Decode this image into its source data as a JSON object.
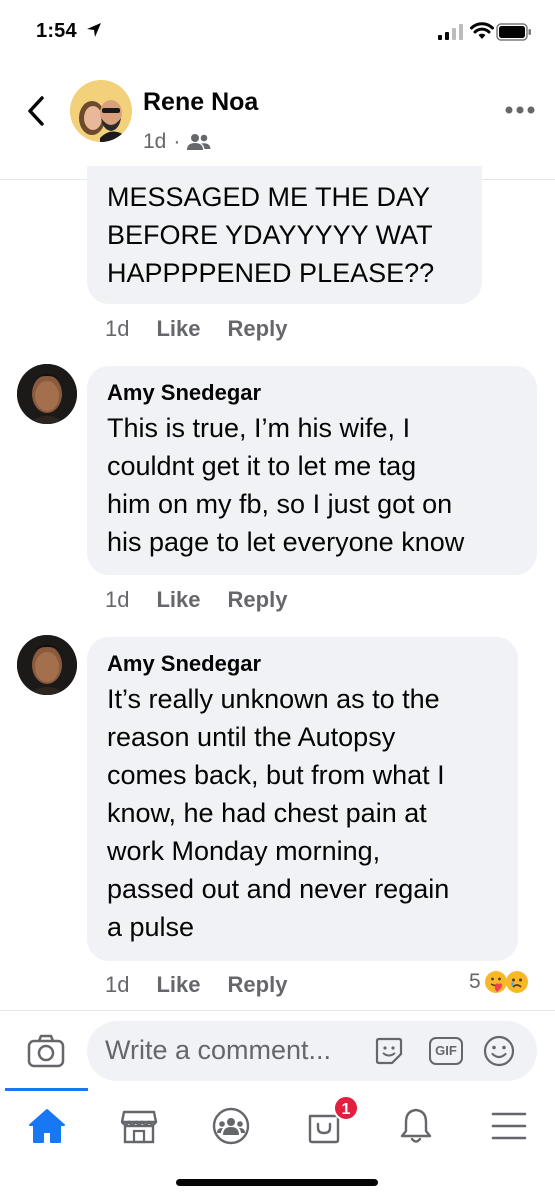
{
  "status_bar": {
    "time": "1:54"
  },
  "header": {
    "author": "Rene Noa",
    "age": "1d",
    "separator": "·"
  },
  "comments": [
    {
      "author": "",
      "text": "MESSAGED ME THE DAY\nBEFORE YDAYYYYY WAT\nHAPPPPENED PLEASE??",
      "age": "1d",
      "like": "Like",
      "reply": "Reply"
    },
    {
      "author": "Amy Snedegar",
      "text": "This is true, I’m his wife, I\ncouldnt get it to let me tag\nhim on my fb, so I just got on\nhis page to let everyone know",
      "age": "1d",
      "like": "Like",
      "reply": "Reply"
    },
    {
      "author": "Amy Snedegar",
      "text": "It’s really unknown as to the\nreason until the Autopsy\ncomes back, but from what I\nknow, he had chest pain at\nwork Monday morning,\npassed out and never regain\na pulse",
      "age": "1d",
      "like": "Like",
      "reply": "Reply",
      "reaction_count": "5"
    }
  ],
  "composer": {
    "placeholder": "Write a comment...",
    "gif_label": "GIF"
  },
  "nav": {
    "items": [
      "home-icon",
      "marketplace-icon",
      "groups-icon",
      "shop-icon",
      "notifications-icon",
      "menu-icon"
    ],
    "badge_count": "1",
    "active": "home"
  },
  "colors": {
    "accent": "#1877f2",
    "bubble": "#f0f2f5",
    "secondary_text": "#65676b",
    "badge": "#e41e3f"
  }
}
